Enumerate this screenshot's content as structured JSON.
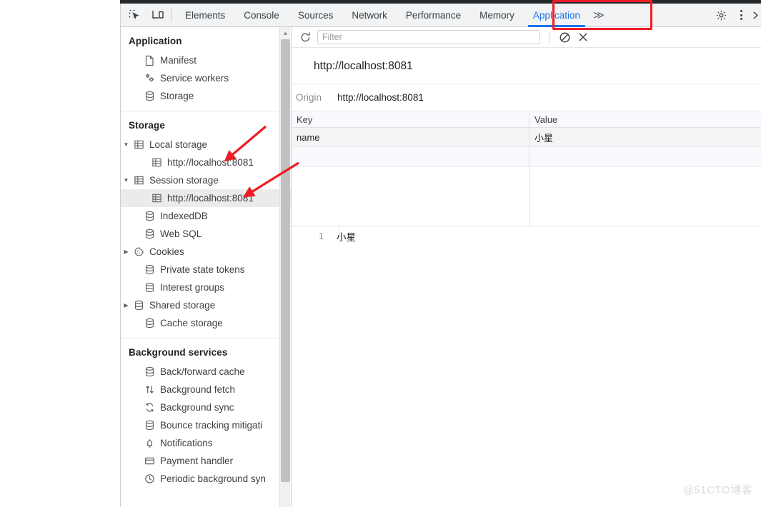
{
  "devtools": {
    "toolbar_icons": [
      {
        "name": "inspect-element-icon"
      },
      {
        "name": "device-toolbar-icon"
      }
    ],
    "tabs": [
      {
        "label": "Elements",
        "active": false
      },
      {
        "label": "Console",
        "active": false
      },
      {
        "label": "Sources",
        "active": false
      },
      {
        "label": "Network",
        "active": false
      },
      {
        "label": "Performance",
        "active": false
      },
      {
        "label": "Memory",
        "active": false
      },
      {
        "label": "Application",
        "active": true
      }
    ],
    "more_tabs_label": "≫",
    "settings_icon": "gear-icon",
    "menu_icon": "three-dot-menu-icon",
    "close_icon": "close-icon"
  },
  "sidebar": {
    "sections": [
      {
        "title": "Application",
        "items": [
          {
            "label": "Manifest",
            "icon": "document-icon",
            "twisty": "",
            "indent": 1,
            "selected": false
          },
          {
            "label": "Service workers",
            "icon": "gears-icon",
            "twisty": "",
            "indent": 1,
            "selected": false
          },
          {
            "label": "Storage",
            "icon": "database-icon",
            "twisty": "",
            "indent": 1,
            "selected": false
          }
        ]
      },
      {
        "title": "Storage",
        "items": [
          {
            "label": "Local storage",
            "icon": "table-icon",
            "twisty": "expanded",
            "indent": 0,
            "selected": false
          },
          {
            "label": "http://localhost:8081",
            "icon": "table-icon",
            "twisty": "",
            "indent": 2,
            "selected": false
          },
          {
            "label": "Session storage",
            "icon": "table-icon",
            "twisty": "expanded",
            "indent": 0,
            "selected": false
          },
          {
            "label": "http://localhost:8081",
            "icon": "table-icon",
            "twisty": "",
            "indent": 2,
            "selected": true
          },
          {
            "label": "IndexedDB",
            "icon": "database-icon",
            "twisty": "",
            "indent": 1,
            "selected": false
          },
          {
            "label": "Web SQL",
            "icon": "database-icon",
            "twisty": "",
            "indent": 1,
            "selected": false
          },
          {
            "label": "Cookies",
            "icon": "cookie-icon",
            "twisty": "collapsed",
            "indent": 0,
            "selected": false
          },
          {
            "label": "Private state tokens",
            "icon": "database-icon",
            "twisty": "",
            "indent": 1,
            "selected": false
          },
          {
            "label": "Interest groups",
            "icon": "database-icon",
            "twisty": "",
            "indent": 1,
            "selected": false
          },
          {
            "label": "Shared storage",
            "icon": "database-icon",
            "twisty": "collapsed",
            "indent": 0,
            "selected": false
          },
          {
            "label": "Cache storage",
            "icon": "database-icon",
            "twisty": "",
            "indent": 1,
            "selected": false
          }
        ]
      },
      {
        "title": "Background services",
        "items": [
          {
            "label": "Back/forward cache",
            "icon": "database-icon",
            "twisty": "",
            "indent": 1,
            "selected": false
          },
          {
            "label": "Background fetch",
            "icon": "arrows-updown-icon",
            "twisty": "",
            "indent": 1,
            "selected": false
          },
          {
            "label": "Background sync",
            "icon": "sync-icon",
            "twisty": "",
            "indent": 1,
            "selected": false
          },
          {
            "label": "Bounce tracking mitigati",
            "icon": "database-icon",
            "twisty": "",
            "indent": 1,
            "selected": false
          },
          {
            "label": "Notifications",
            "icon": "bell-icon",
            "twisty": "",
            "indent": 1,
            "selected": false
          },
          {
            "label": "Payment handler",
            "icon": "card-icon",
            "twisty": "",
            "indent": 1,
            "selected": false
          },
          {
            "label": "Periodic background syn",
            "icon": "clock-icon",
            "twisty": "",
            "indent": 1,
            "selected": false
          }
        ]
      }
    ]
  },
  "main": {
    "toolbar": {
      "refresh_icon": "refresh-icon",
      "filter_placeholder": "Filter",
      "filter_value": "",
      "clear_icon": "no-entry-icon",
      "delete_icon": "close-x-icon"
    },
    "origin_title": "http://localhost:8081",
    "origin_label": "Origin",
    "origin_value": "http://localhost:8081",
    "table": {
      "columns": [
        "Key",
        "Value"
      ],
      "rows": [
        {
          "key": "name",
          "value": "小星",
          "selected": true
        }
      ]
    },
    "preview": {
      "line_number": "1",
      "content": "小星"
    }
  },
  "annotations": {
    "highlight_target": "Application",
    "arrow_targets": [
      "Local storage",
      "Session storage"
    ],
    "color": "#ee1c25"
  },
  "watermark": "@51CTO博客"
}
